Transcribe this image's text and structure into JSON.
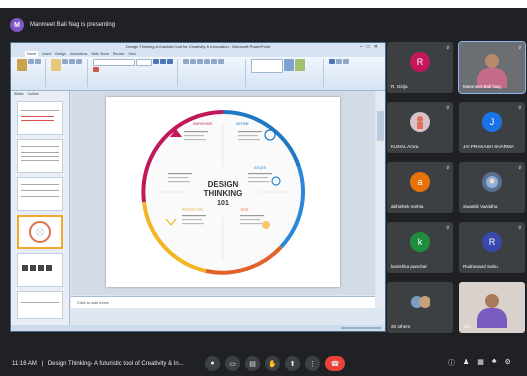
{
  "header": {
    "presenter_initial": "M",
    "presenting_text": "Manmeet Bali Nag is presenting"
  },
  "ppt": {
    "window_title": "Design Thinking-A futuristic tool for Creativity & Innovation - Microsoft PowerPoint",
    "tabs": [
      "Home",
      "Insert",
      "Design",
      "Animations",
      "Slide Show",
      "Review",
      "View"
    ],
    "panel_tabs": [
      "Slides",
      "Outline"
    ],
    "notes_placeholder": "Click to add notes",
    "slide": {
      "center_title": "DESIGN THINKING 101",
      "stages": [
        "EMPATHIZE",
        "DEFINE",
        "IDEATE",
        "PROTOTYPE",
        "TEST"
      ]
    }
  },
  "participants": [
    {
      "initial": "R",
      "name": "R. Girija",
      "color": "#c2185b",
      "type": "avatar"
    },
    {
      "initial": "",
      "name": "Manmeet Bali Nag",
      "type": "video"
    },
    {
      "initial": "",
      "name": "KUNAL Arora",
      "type": "photo"
    },
    {
      "initial": "J",
      "name": "JAI PRAKASH SHARMA",
      "color": "#1a73e8",
      "type": "avatar"
    },
    {
      "initial": "a",
      "name": "abhishek mehta",
      "color": "#e8710a",
      "type": "avatar"
    },
    {
      "initial": "",
      "name": "Swastik Vasistha",
      "type": "photo"
    },
    {
      "initial": "k",
      "name": "kanishka panchal",
      "color": "#1e8e3e",
      "type": "avatar"
    },
    {
      "initial": "R",
      "name": "Rudranand Sahu",
      "color": "#3949ab",
      "type": "avatar"
    },
    {
      "initial": "",
      "name": "20 others",
      "type": "group"
    },
    {
      "initial": "",
      "name": "You",
      "type": "video"
    }
  ],
  "footer": {
    "time": "11:16 AM",
    "separator": "|",
    "meeting_title": "Design Thinking- A futuristic tool of Creativity & In..."
  },
  "colors": {
    "background": "#202124",
    "tile": "#3c4043",
    "end_call": "#ea4335"
  }
}
